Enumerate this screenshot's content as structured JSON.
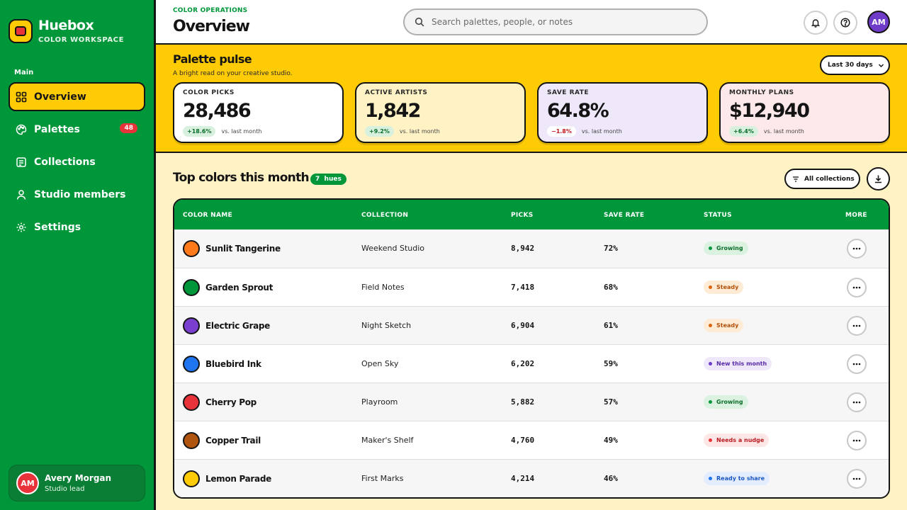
{
  "brand": {
    "name": "Huebox",
    "subtitle": "COLOR WORKSPACE"
  },
  "sidebar": {
    "section_label": "Main",
    "items": [
      {
        "label": "Overview",
        "icon": "grid-icon",
        "active": true
      },
      {
        "label": "Palettes",
        "icon": "palette-icon",
        "badge": "48"
      },
      {
        "label": "Collections",
        "icon": "collection-icon"
      },
      {
        "label": "Studio members",
        "icon": "user-icon"
      },
      {
        "label": "Settings",
        "icon": "gear-icon"
      }
    ],
    "user": {
      "initials": "AM",
      "name": "Avery Morgan",
      "role": "Studio lead"
    }
  },
  "header": {
    "eyebrow": "COLOR OPERATIONS",
    "title": "Overview",
    "search_placeholder": "Search palettes, people, or notes",
    "avatar_initials": "AM"
  },
  "pulse": {
    "title": "Palette pulse",
    "subtitle": "A bright read on your creative studio.",
    "range_label": "Last 30 days",
    "stats": [
      {
        "label": "COLOR PICKS",
        "value": "28,486",
        "change": "+18.6%",
        "trend": "up",
        "comparison": "vs. last month",
        "bg": "#ffffff"
      },
      {
        "label": "ACTIVE ARTISTS",
        "value": "1,842",
        "change": "+9.2%",
        "trend": "up",
        "comparison": "vs. last month",
        "bg": "#fff3c6"
      },
      {
        "label": "SAVE RATE",
        "value": "64.8%",
        "change": "−1.8%",
        "trend": "down",
        "comparison": "vs. last month",
        "bg": "#efe8fa"
      },
      {
        "label": "MONTHLY PLANS",
        "value": "$12,940",
        "change": "+6.4%",
        "trend": "up",
        "comparison": "vs. last month",
        "bg": "#fde9e9"
      }
    ]
  },
  "top_colors": {
    "title": "Top colors this month",
    "hue_count": "7",
    "hue_label": "hues",
    "filter_label": "All collections",
    "columns": [
      "COLOR NAME",
      "COLLECTION",
      "PICKS",
      "SAVE RATE",
      "STATUS",
      "MORE"
    ],
    "rows": [
      {
        "name": "Sunlit Tangerine",
        "swatch": "#ff7a1a",
        "collection": "Weekend Studio",
        "picks": "8,942",
        "save_rate": "72%",
        "status": "Growing",
        "status_bg": "#dcf2e1",
        "status_fg": "#0a6e2a",
        "status_dot": "#00973a"
      },
      {
        "name": "Garden Sprout",
        "swatch": "#00973a",
        "collection": "Field Notes",
        "picks": "7,418",
        "save_rate": "68%",
        "status": "Steady",
        "status_bg": "#fdebd6",
        "status_fg": "#b3500c",
        "status_dot": "#d9650f"
      },
      {
        "name": "Electric Grape",
        "swatch": "#7b3fd0",
        "collection": "Night Sketch",
        "picks": "6,904",
        "save_rate": "61%",
        "status": "Steady",
        "status_bg": "#fdebd6",
        "status_fg": "#b3500c",
        "status_dot": "#d9650f"
      },
      {
        "name": "Bluebird Ink",
        "swatch": "#1f74f0",
        "collection": "Open Sky",
        "picks": "6,202",
        "save_rate": "59%",
        "status": "New this month",
        "status_bg": "#efe8fa",
        "status_fg": "#5a2aa8",
        "status_dot": "#6e3cc8"
      },
      {
        "name": "Cherry Pop",
        "swatch": "#e8333b",
        "collection": "Playroom",
        "picks": "5,882",
        "save_rate": "57%",
        "status": "Growing",
        "status_bg": "#dcf2e1",
        "status_fg": "#0a6e2a",
        "status_dot": "#00973a"
      },
      {
        "name": "Copper Trail",
        "swatch": "#b0550f",
        "collection": "Maker's Shelf",
        "picks": "4,760",
        "save_rate": "49%",
        "status": "Needs a nudge",
        "status_bg": "#fde6e6",
        "status_fg": "#b81c22",
        "status_dot": "#e8333b"
      },
      {
        "name": "Lemon Parade",
        "swatch": "#ffcb05",
        "collection": "First Marks",
        "picks": "4,214",
        "save_rate": "46%",
        "status": "Ready to share",
        "status_bg": "#e3edfd",
        "status_fg": "#1a56c2",
        "status_dot": "#1f74f0"
      }
    ]
  }
}
